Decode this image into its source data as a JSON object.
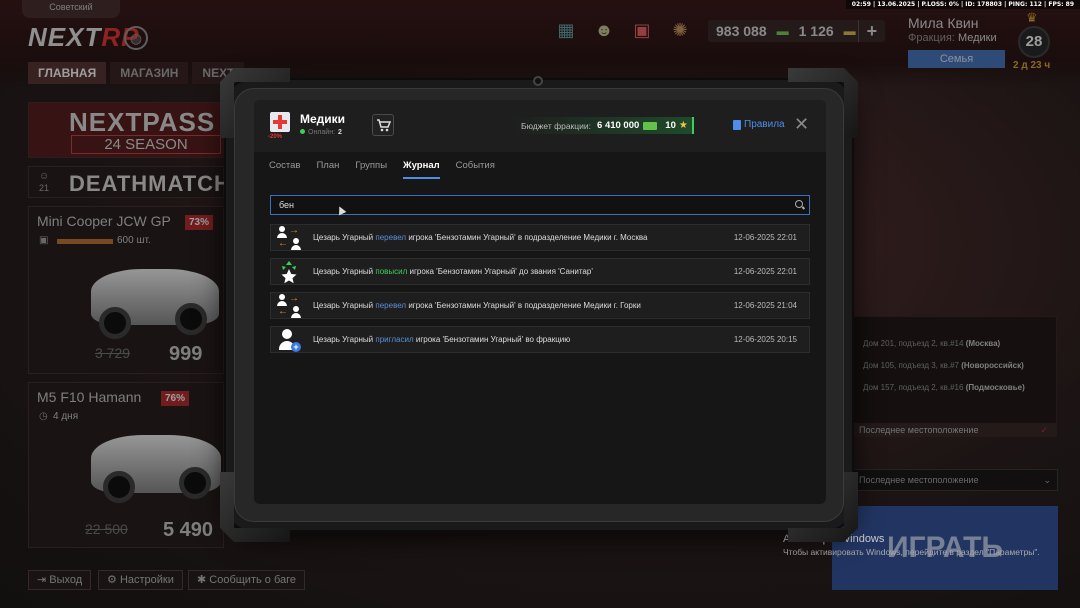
{
  "sysbar": "02:59 | 13.06.2025 | P.LOSS: 0% | ID: 178803 | PING: 112 | FPS: 89",
  "launcher": {
    "server_tag": "Советский",
    "logo_main": "NEXT",
    "logo_accent": "RP",
    "nav": [
      {
        "label": "ГЛАВНАЯ"
      },
      {
        "label": "МАГАЗИН"
      },
      {
        "label": "NEXT"
      }
    ],
    "money": "983 088",
    "coins": "1 126",
    "plus": "+",
    "user_name": "Мила Квин",
    "faction_label": "Фракция:",
    "faction_value": "Медики",
    "family_button": "Семья",
    "level": "28",
    "level_time": "2 д 23 ч",
    "promo_title": "NEXTPASS",
    "promo_sub": "24 SEASON",
    "deathmatch": "DEATHMATCH",
    "deathmatch_count": "21",
    "cars": [
      {
        "title": "Mini Cooper JCW GP",
        "pct": "73%",
        "stock": "600 шт.",
        "old_price": "3 729",
        "new_price": "999"
      },
      {
        "title": "M5 F10 Hamann",
        "pct": "76%",
        "stock": "4 дня",
        "old_price": "22 500",
        "new_price": "5 490"
      }
    ],
    "bottom_buttons": [
      {
        "label": "Выход"
      },
      {
        "label": "Настройки"
      },
      {
        "label": "Сообщить о баге"
      }
    ],
    "addresses": [
      {
        "text": "Дом 201, подъезд 2, кв.#14",
        "city": "(Москва)"
      },
      {
        "text": "Дом 105, подъезд 3, кв.#7",
        "city": "(Новороссийск)"
      },
      {
        "text": "Дом 157, подъезд 2, кв.#16",
        "city": "(Подмосковье)"
      }
    ],
    "last_location": "Последнее местоположение",
    "location_select": "Последнее местоположение",
    "play_button": "ИГРАТЬ",
    "win_activation_title": "Активация Windows",
    "win_activation_text": "Чтобы активировать Windows, перейдите в раздел \"Параметры\"."
  },
  "tablet": {
    "faction": {
      "name": "Медики",
      "discount": "-20%",
      "online_label": "Онлайн:",
      "online_count": "2"
    },
    "budget": {
      "label": "Бюджет фракции:",
      "value": "6 410 000",
      "stars": "10"
    },
    "rules_label": "Правила",
    "close": "✕",
    "tabs": [
      {
        "label": "Состав",
        "active": false
      },
      {
        "label": "План",
        "active": false
      },
      {
        "label": "Группы",
        "active": false
      },
      {
        "label": "Журнал",
        "active": true
      },
      {
        "label": "События",
        "active": false
      }
    ],
    "search": {
      "value": "бен",
      "placeholder": ""
    },
    "log": [
      {
        "icon": "transfer-icon",
        "actor": "Цезарь Угарный",
        "action": "перевел",
        "text": "игрока 'Бензотамин Угарный' в подразделение Медики г. Москва",
        "time": "12-06-2025 22:01"
      },
      {
        "icon": "promote-icon",
        "actor": "Цезарь Угарный",
        "action": "повысил",
        "text": "игрока 'Бензотамин Угарный' до звания 'Санитар'",
        "time": "12-06-2025 22:01"
      },
      {
        "icon": "transfer-icon",
        "actor": "Цезарь Угарный",
        "action": "перевел",
        "text": "игрока 'Бензотамин Угарный' в подразделение Медики г. Горки",
        "time": "12-06-2025 21:04"
      },
      {
        "icon": "invite-icon",
        "actor": "Цезарь Угарный",
        "action": "пригласил",
        "text": "игрока 'Бензотамин Угарный' во фракцию",
        "time": "12-06-2025 20:15"
      }
    ]
  },
  "colors": {
    "accent_blue": "#4f8ee8",
    "promote_green": "#3ecf5a",
    "transfer_orange": "#f08a24",
    "alert_red": "#e53935"
  }
}
